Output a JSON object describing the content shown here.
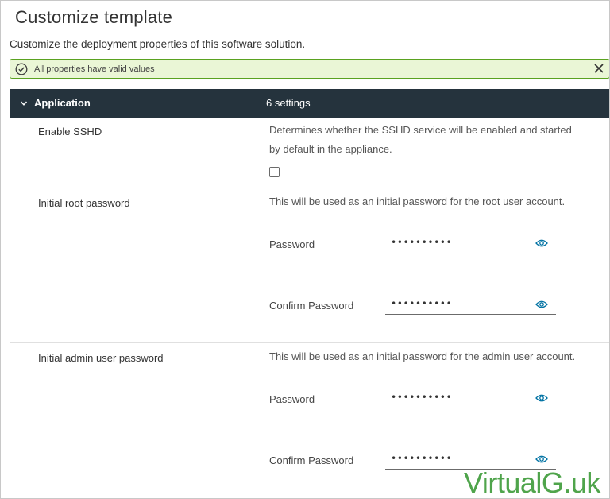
{
  "page": {
    "title": "Customize template",
    "subtitle": "Customize the deployment properties of this software solution."
  },
  "alert": {
    "text": "All properties have valid values",
    "icon": "check-circle-icon",
    "close_icon": "close-icon",
    "colors": {
      "background": "#eaf6d6",
      "border": "#5aa220"
    }
  },
  "section": {
    "title": "Application",
    "count": "6 settings",
    "expanded": true,
    "header_color": "#25333d"
  },
  "settings": {
    "sshd": {
      "label": "Enable SSHD",
      "description_line1": "Determines whether the SSHD service will be enabled and started",
      "description_line2": "by default in the appliance.",
      "checked": false
    },
    "root_password": {
      "label": "Initial root password",
      "description": "This will be used as an initial password for the root user account.",
      "password_label": "Password",
      "password_value": "••••••••••",
      "confirm_label": "Confirm Password",
      "confirm_value": "••••••••••"
    },
    "admin_password": {
      "label": "Initial admin user password",
      "description": "This will be used as an initial password for the admin user account.",
      "password_label": "Password",
      "password_value": "••••••••••",
      "confirm_label": "Confirm Password",
      "confirm_value": "••••••••••"
    }
  },
  "watermark": {
    "text": "VirtualG.uk",
    "color": "#4fa44b"
  }
}
